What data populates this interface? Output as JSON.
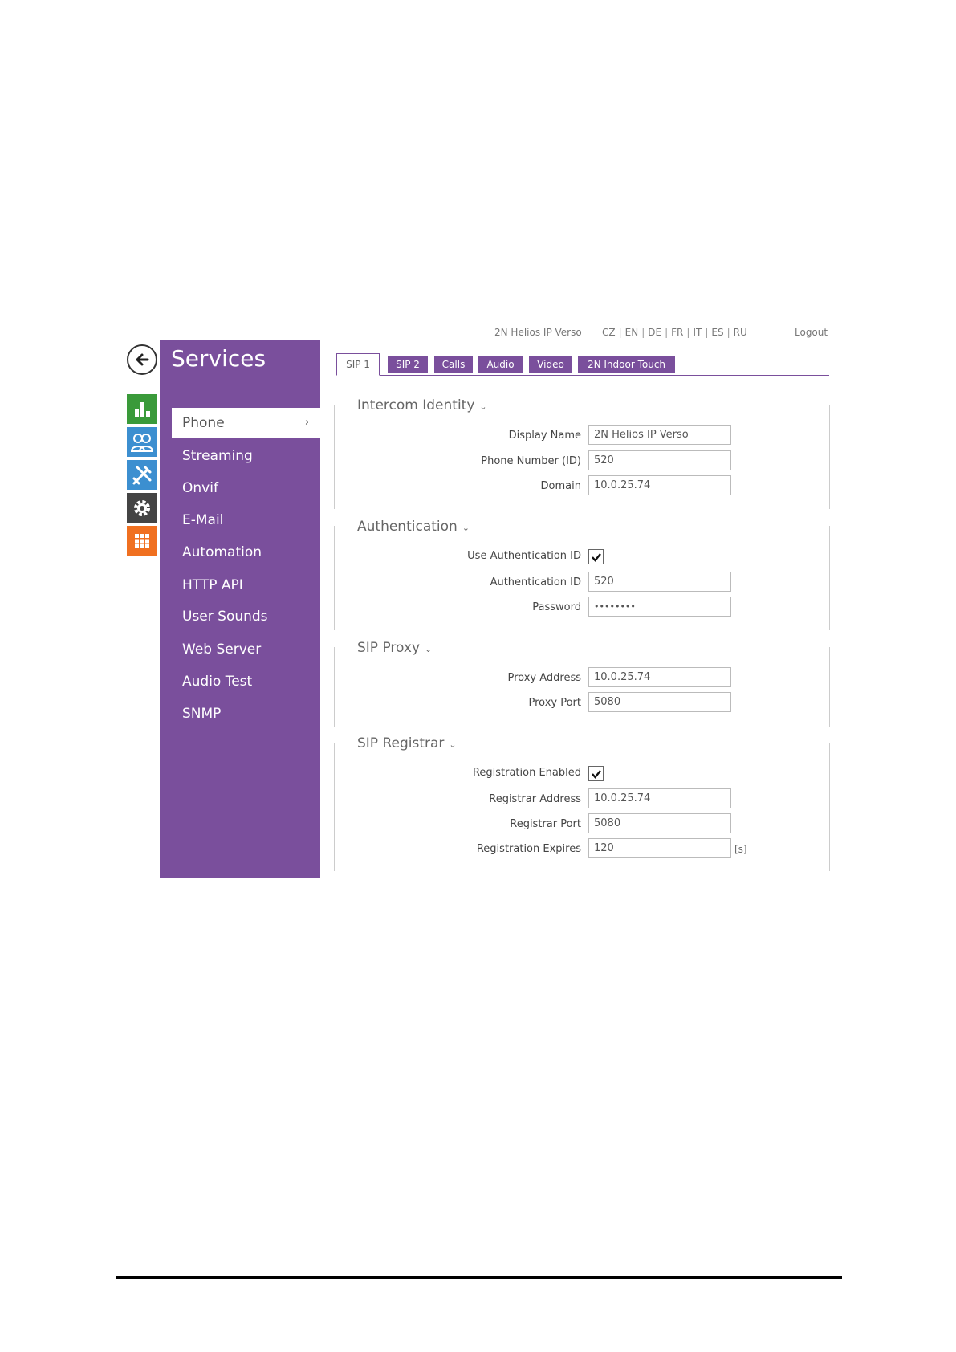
{
  "header": {
    "device_name": "2N Helios IP Verso",
    "languages": [
      "CZ",
      "EN",
      "DE",
      "FR",
      "IT",
      "ES",
      "RU"
    ],
    "logout": "Logout"
  },
  "rail": {
    "icons": [
      {
        "name": "status-icon",
        "color": "#3a9a3a"
      },
      {
        "name": "directory-icon",
        "color": "#3c8fd0"
      },
      {
        "name": "hardware-icon",
        "color": "#3c8fd0"
      },
      {
        "name": "system-icon",
        "color": "#444444"
      },
      {
        "name": "services-icon",
        "color": "#f07020"
      }
    ]
  },
  "sidebar": {
    "title": "Services",
    "items": [
      {
        "label": "Phone",
        "active": true
      },
      {
        "label": "Streaming"
      },
      {
        "label": "Onvif"
      },
      {
        "label": "E-Mail"
      },
      {
        "label": "Automation"
      },
      {
        "label": "HTTP API"
      },
      {
        "label": "User Sounds"
      },
      {
        "label": "Web Server"
      },
      {
        "label": "Audio Test"
      },
      {
        "label": "SNMP"
      }
    ],
    "chevron": "›"
  },
  "tabs": [
    {
      "label": "SIP 1",
      "active": true
    },
    {
      "label": "SIP 2"
    },
    {
      "label": "Calls"
    },
    {
      "label": "Audio"
    },
    {
      "label": "Video"
    },
    {
      "label": "2N Indoor Touch"
    }
  ],
  "sections": {
    "identity": {
      "title": "Intercom Identity",
      "display_name_label": "Display Name",
      "display_name": "2N Helios IP Verso",
      "phone_number_label": "Phone Number (ID)",
      "phone_number": "520",
      "domain_label": "Domain",
      "domain": "10.0.25.74"
    },
    "auth": {
      "title": "Authentication",
      "use_auth_label": "Use Authentication ID",
      "use_auth_checked": true,
      "auth_id_label": "Authentication ID",
      "auth_id": "520",
      "password_label": "Password",
      "password": "••••••••"
    },
    "proxy": {
      "title": "SIP Proxy",
      "address_label": "Proxy Address",
      "address": "10.0.25.74",
      "port_label": "Proxy Port",
      "port": "5080"
    },
    "registrar": {
      "title": "SIP Registrar",
      "enabled_label": "Registration Enabled",
      "enabled_checked": true,
      "address_label": "Registrar Address",
      "address": "10.0.25.74",
      "port_label": "Registrar Port",
      "port": "5080",
      "expires_label": "Registration Expires",
      "expires": "120",
      "expires_unit": "[s]"
    }
  },
  "colors": {
    "accent": "#7a4f9c"
  }
}
